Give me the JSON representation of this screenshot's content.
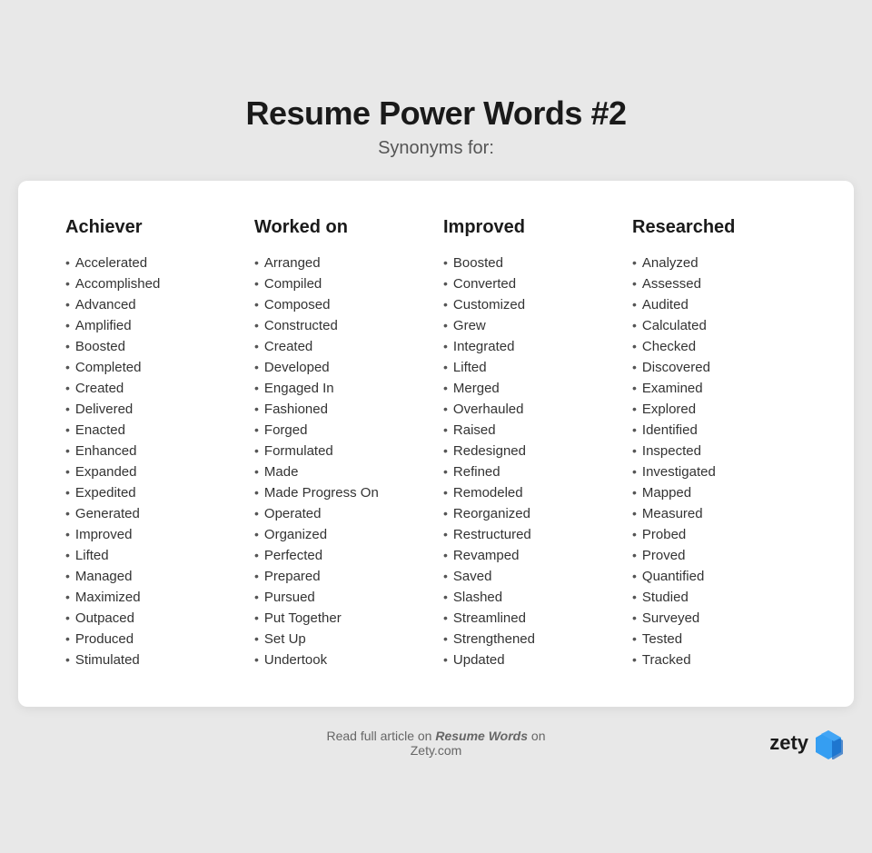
{
  "header": {
    "title": "Resume Power Words #2",
    "subtitle": "Synonyms for:"
  },
  "columns": [
    {
      "title": "Achiever",
      "words": [
        "Accelerated",
        "Accomplished",
        "Advanced",
        "Amplified",
        "Boosted",
        "Completed",
        "Created",
        "Delivered",
        "Enacted",
        "Enhanced",
        "Expanded",
        "Expedited",
        "Generated",
        "Improved",
        "Lifted",
        "Managed",
        "Maximized",
        "Outpaced",
        "Produced",
        "Stimulated"
      ]
    },
    {
      "title": "Worked on",
      "words": [
        "Arranged",
        "Compiled",
        "Composed",
        "Constructed",
        "Created",
        "Developed",
        "Engaged In",
        "Fashioned",
        "Forged",
        "Formulated",
        "Made",
        "Made Progress On",
        "Operated",
        "Organized",
        "Perfected",
        "Prepared",
        "Pursued",
        "Put Together",
        "Set Up",
        "Undertook"
      ]
    },
    {
      "title": "Improved",
      "words": [
        "Boosted",
        "Converted",
        "Customized",
        "Grew",
        "Integrated",
        "Lifted",
        "Merged",
        "Overhauled",
        "Raised",
        "Redesigned",
        "Refined",
        "Remodeled",
        "Reorganized",
        "Restructured",
        "Revamped",
        "Saved",
        "Slashed",
        "Streamlined",
        "Strengthened",
        "Updated"
      ]
    },
    {
      "title": "Researched",
      "words": [
        "Analyzed",
        "Assessed",
        "Audited",
        "Calculated",
        "Checked",
        "Discovered",
        "Examined",
        "Explored",
        "Identified",
        "Inspected",
        "Investigated",
        "Mapped",
        "Measured",
        "Probed",
        "Proved",
        "Quantified",
        "Studied",
        "Surveyed",
        "Tested",
        "Tracked"
      ]
    }
  ],
  "footer": {
    "text_before": "Read full article on ",
    "link_text": "Resume Words",
    "text_after": " on Zety.com"
  },
  "logo": {
    "text": "zety"
  }
}
